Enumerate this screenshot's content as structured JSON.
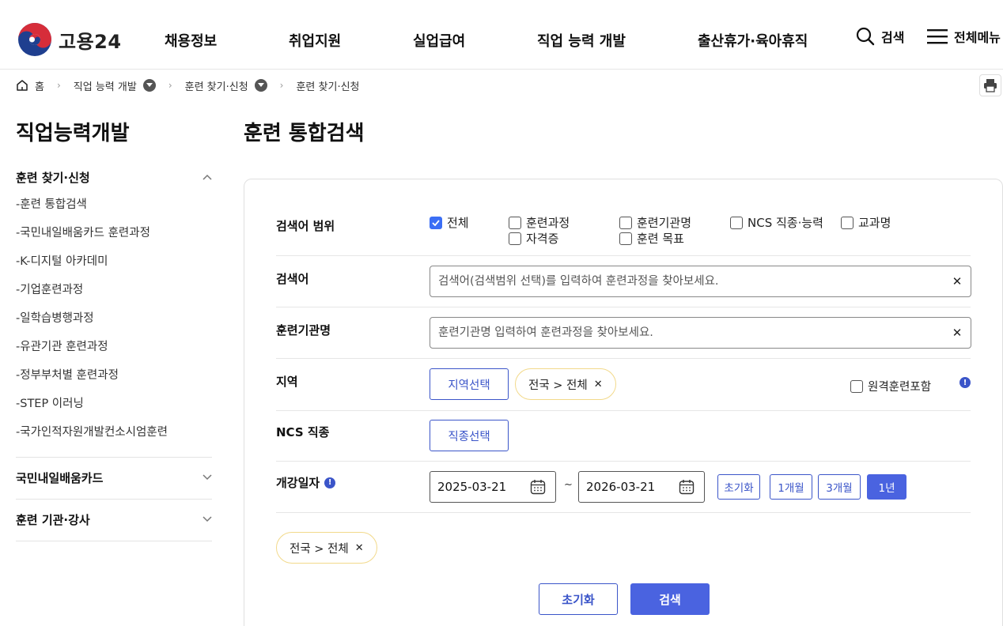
{
  "header": {
    "logo_text": "고용24",
    "nav": [
      "채용정보",
      "취업지원",
      "실업급여",
      "직업 능력 개발",
      "출산휴가·육아휴직"
    ],
    "search_label": "검색",
    "menu_label": "전체메뉴"
  },
  "breadcrumb": {
    "home": "홈",
    "level1": "직업 능력 개발",
    "level2": "훈련 찾기·신청",
    "current": "훈련 찾기·신청"
  },
  "sidebar": {
    "title": "직업능력개발",
    "groups": [
      {
        "label": "훈련 찾기·신청",
        "items": [
          "훈련 통합검색",
          "국민내일배움카드 훈련과정",
          "K-디지털 아카데미",
          "기업훈련과정",
          "일학습병행과정",
          "유관기관 훈련과정",
          "정부부처별 훈련과정",
          "STEP 이러닝",
          "국가인적자원개발컨소시엄훈련"
        ]
      },
      {
        "label": "국민내일배움카드"
      },
      {
        "label": "훈련 기관·강사"
      }
    ]
  },
  "main": {
    "title": "훈련 통합검색",
    "scope": {
      "label": "검색어 범위",
      "options": [
        "전체",
        "훈련과정",
        "훈련기관명",
        "NCS 직종·능력",
        "교과명",
        "자격증",
        "훈련 목표"
      ],
      "checked": "전체"
    },
    "keyword": {
      "label": "검색어",
      "placeholder": "검색어(검색범위 선택)를 입력하여 훈련과정을 찾아보세요."
    },
    "institution": {
      "label": "훈련기관명",
      "placeholder": "훈련기관명 입력하여 훈련과정을 찾아보세요."
    },
    "region": {
      "label": "지역",
      "select_button": "지역선택",
      "chip": "전국 > 전체",
      "remote_label": "원격훈련포함"
    },
    "ncs": {
      "label": "NCS 직종",
      "select_button": "직종선택"
    },
    "date": {
      "label": "개강일자",
      "start": "2025-03-21",
      "tilde": "~",
      "end": "2026-03-21",
      "buttons": [
        "초기화",
        "1개월",
        "3개월",
        "1년"
      ],
      "active": "1년"
    },
    "summary_chip": "전국 > 전체",
    "reset_button": "초기화",
    "search_button": "검색"
  },
  "colors": {
    "primary": "#4a63e0",
    "chip_border": "#f2d98a"
  }
}
